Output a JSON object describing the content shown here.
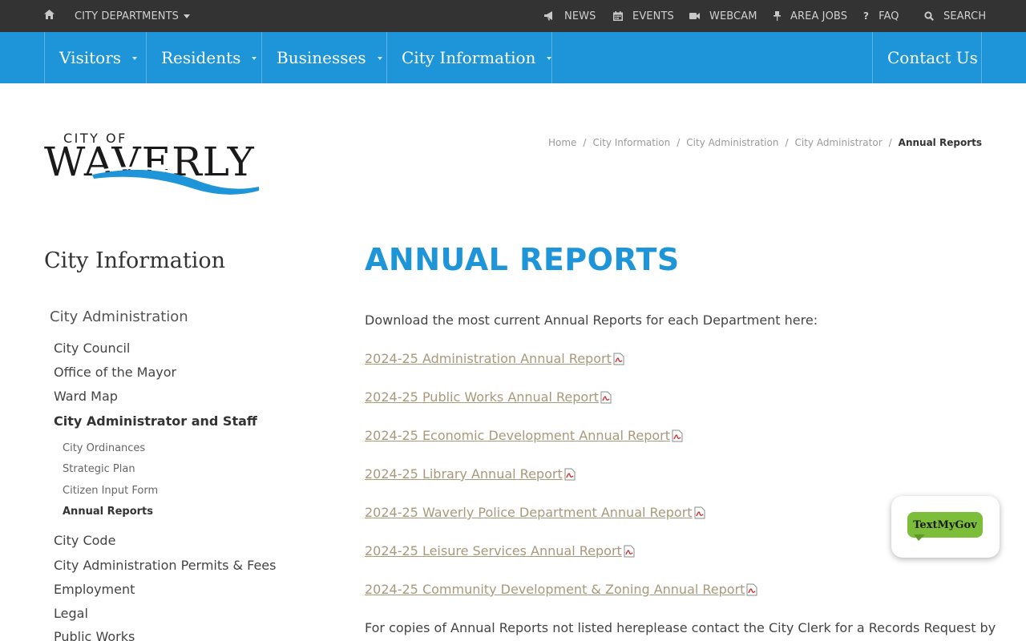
{
  "topbar": {
    "departments_label": "CITY DEPARTMENTS",
    "links": [
      {
        "label": "NEWS",
        "icon": "megaphone-icon"
      },
      {
        "label": "EVENTS",
        "icon": "calendar-icon"
      },
      {
        "label": "WEBCAM",
        "icon": "video-camera-icon"
      },
      {
        "label": "AREA JOBS",
        "icon": "pushpin-icon"
      },
      {
        "label": "FAQ",
        "icon": "question-icon"
      },
      {
        "label": "SEARCH",
        "icon": "search-icon"
      }
    ]
  },
  "mainnav": {
    "items": [
      {
        "label": "Visitors"
      },
      {
        "label": "Residents"
      },
      {
        "label": "Businesses"
      },
      {
        "label": "City Information"
      }
    ],
    "contact_label": "Contact Us"
  },
  "logo": {
    "line1": "CITY OF",
    "line2": "WAVERLY"
  },
  "breadcrumb": {
    "items": [
      "Home",
      "City Information",
      "City Administration",
      "City Administrator"
    ],
    "current": "Annual Reports"
  },
  "sidebar": {
    "title": "City Information",
    "section": "City Administration",
    "items": [
      {
        "label": "City Council"
      },
      {
        "label": "Office of the Mayor"
      },
      {
        "label": "Ward Map"
      },
      {
        "label": "City Administrator and Staff"
      }
    ],
    "subitems": [
      {
        "label": "City Ordinances"
      },
      {
        "label": "Strategic Plan"
      },
      {
        "label": "Citizen Input Form"
      },
      {
        "label": "Annual Reports"
      }
    ],
    "more_items": [
      {
        "label": "City Code"
      },
      {
        "label": "City Administration Permits & Fees"
      },
      {
        "label": "Employment"
      },
      {
        "label": "Legal"
      },
      {
        "label": "Public Works"
      }
    ]
  },
  "main": {
    "title": "ANNUAL REPORTS",
    "intro": "Download the most current Annual Reports for each Department here:",
    "reports": [
      {
        "label": "2024-25 Administration Annual Report"
      },
      {
        "label": "2024-25 Public Works Annual Report"
      },
      {
        "label": "2024-25 Economic Development Annual Report"
      },
      {
        "label": "2024-25 Library Annual Report"
      },
      {
        "label": "2024-25 Waverly Police Department Annual Report"
      },
      {
        "label": "2024-25 Leisure Services Annual Report"
      },
      {
        "label": "2024-25 Community Development & Zoning Annual Report"
      }
    ],
    "footer": "For copies of Annual Reports not listed hereplease contact the City Clerk for a Records Request by"
  },
  "widget": {
    "label": "TextMyGov"
  },
  "colors": {
    "topbar": "#333333",
    "nav": "#1d95d8",
    "title": "#1d95d8",
    "link": "#a8997a",
    "widget_green": "#7cbd3a"
  }
}
